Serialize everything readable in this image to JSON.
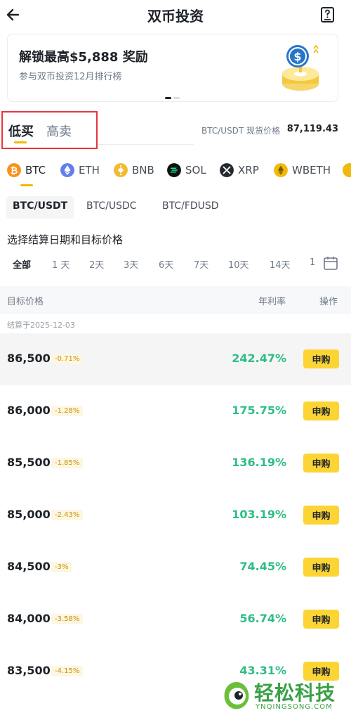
{
  "header": {
    "title": "双币投资",
    "back_icon": "arrow-left-icon",
    "doc_icon": "question-doc-icon"
  },
  "banner": {
    "title": "解锁最高$5,888 奖励",
    "subtitle": "参与双币投资12月排行榜",
    "art_icon": "usdc-coin-reward-illustration"
  },
  "tabs": {
    "buy_low": "低买",
    "sell_high": "高卖",
    "highlight_color": "#e8373d"
  },
  "spot": {
    "label": "BTC/USDT 现货价格",
    "value": "87,119.43"
  },
  "coins": [
    {
      "symbol": "BTC",
      "color": "#f7931a",
      "icon": "btc-icon"
    },
    {
      "symbol": "ETH",
      "color": "#627eea",
      "icon": "eth-icon"
    },
    {
      "symbol": "BNB",
      "color": "#f3ba2f",
      "icon": "bnb-icon"
    },
    {
      "symbol": "SOL",
      "color": "#111111",
      "icon": "sol-icon"
    },
    {
      "symbol": "XRP",
      "color": "#23292f",
      "icon": "xrp-icon"
    },
    {
      "symbol": "WBETH",
      "color": "#f0b90b",
      "icon": "wbeth-icon"
    }
  ],
  "pairs": [
    "BTC/USDT",
    "BTC/USDC",
    "BTC/FDUSD"
  ],
  "dates": {
    "title": "选择结算日期和目标价格",
    "options": [
      "全部",
      "1 天",
      "2天",
      "3天",
      "6天",
      "7天",
      "10天",
      "14天",
      "1"
    ]
  },
  "table": {
    "col_target": "目标价格",
    "col_apy": "年利率",
    "col_action": "操作",
    "settle_date": "结算于2025-12-03",
    "button_label": "申购",
    "rows": [
      {
        "price": "86,500",
        "diff": "-0.71%",
        "apy": "242.47%"
      },
      {
        "price": "86,000",
        "diff": "-1.28%",
        "apy": "175.75%"
      },
      {
        "price": "85,500",
        "diff": "-1.85%",
        "apy": "136.19%"
      },
      {
        "price": "85,000",
        "diff": "-2.43%",
        "apy": "103.19%"
      },
      {
        "price": "84,500",
        "diff": "-3%",
        "apy": "74.45%"
      },
      {
        "price": "84,000",
        "diff": "-3.58%",
        "apy": "56.74%"
      },
      {
        "price": "83,500",
        "diff": "-4.15%",
        "apy": "43.31%"
      }
    ]
  },
  "colors": {
    "accent": "#f0b90b",
    "button": "#fcd535",
    "positive": "#2ebd85"
  },
  "watermark": {
    "text": "轻松科技",
    "sub": "YNQINGSONG.COM",
    "color": "#3aa046"
  }
}
